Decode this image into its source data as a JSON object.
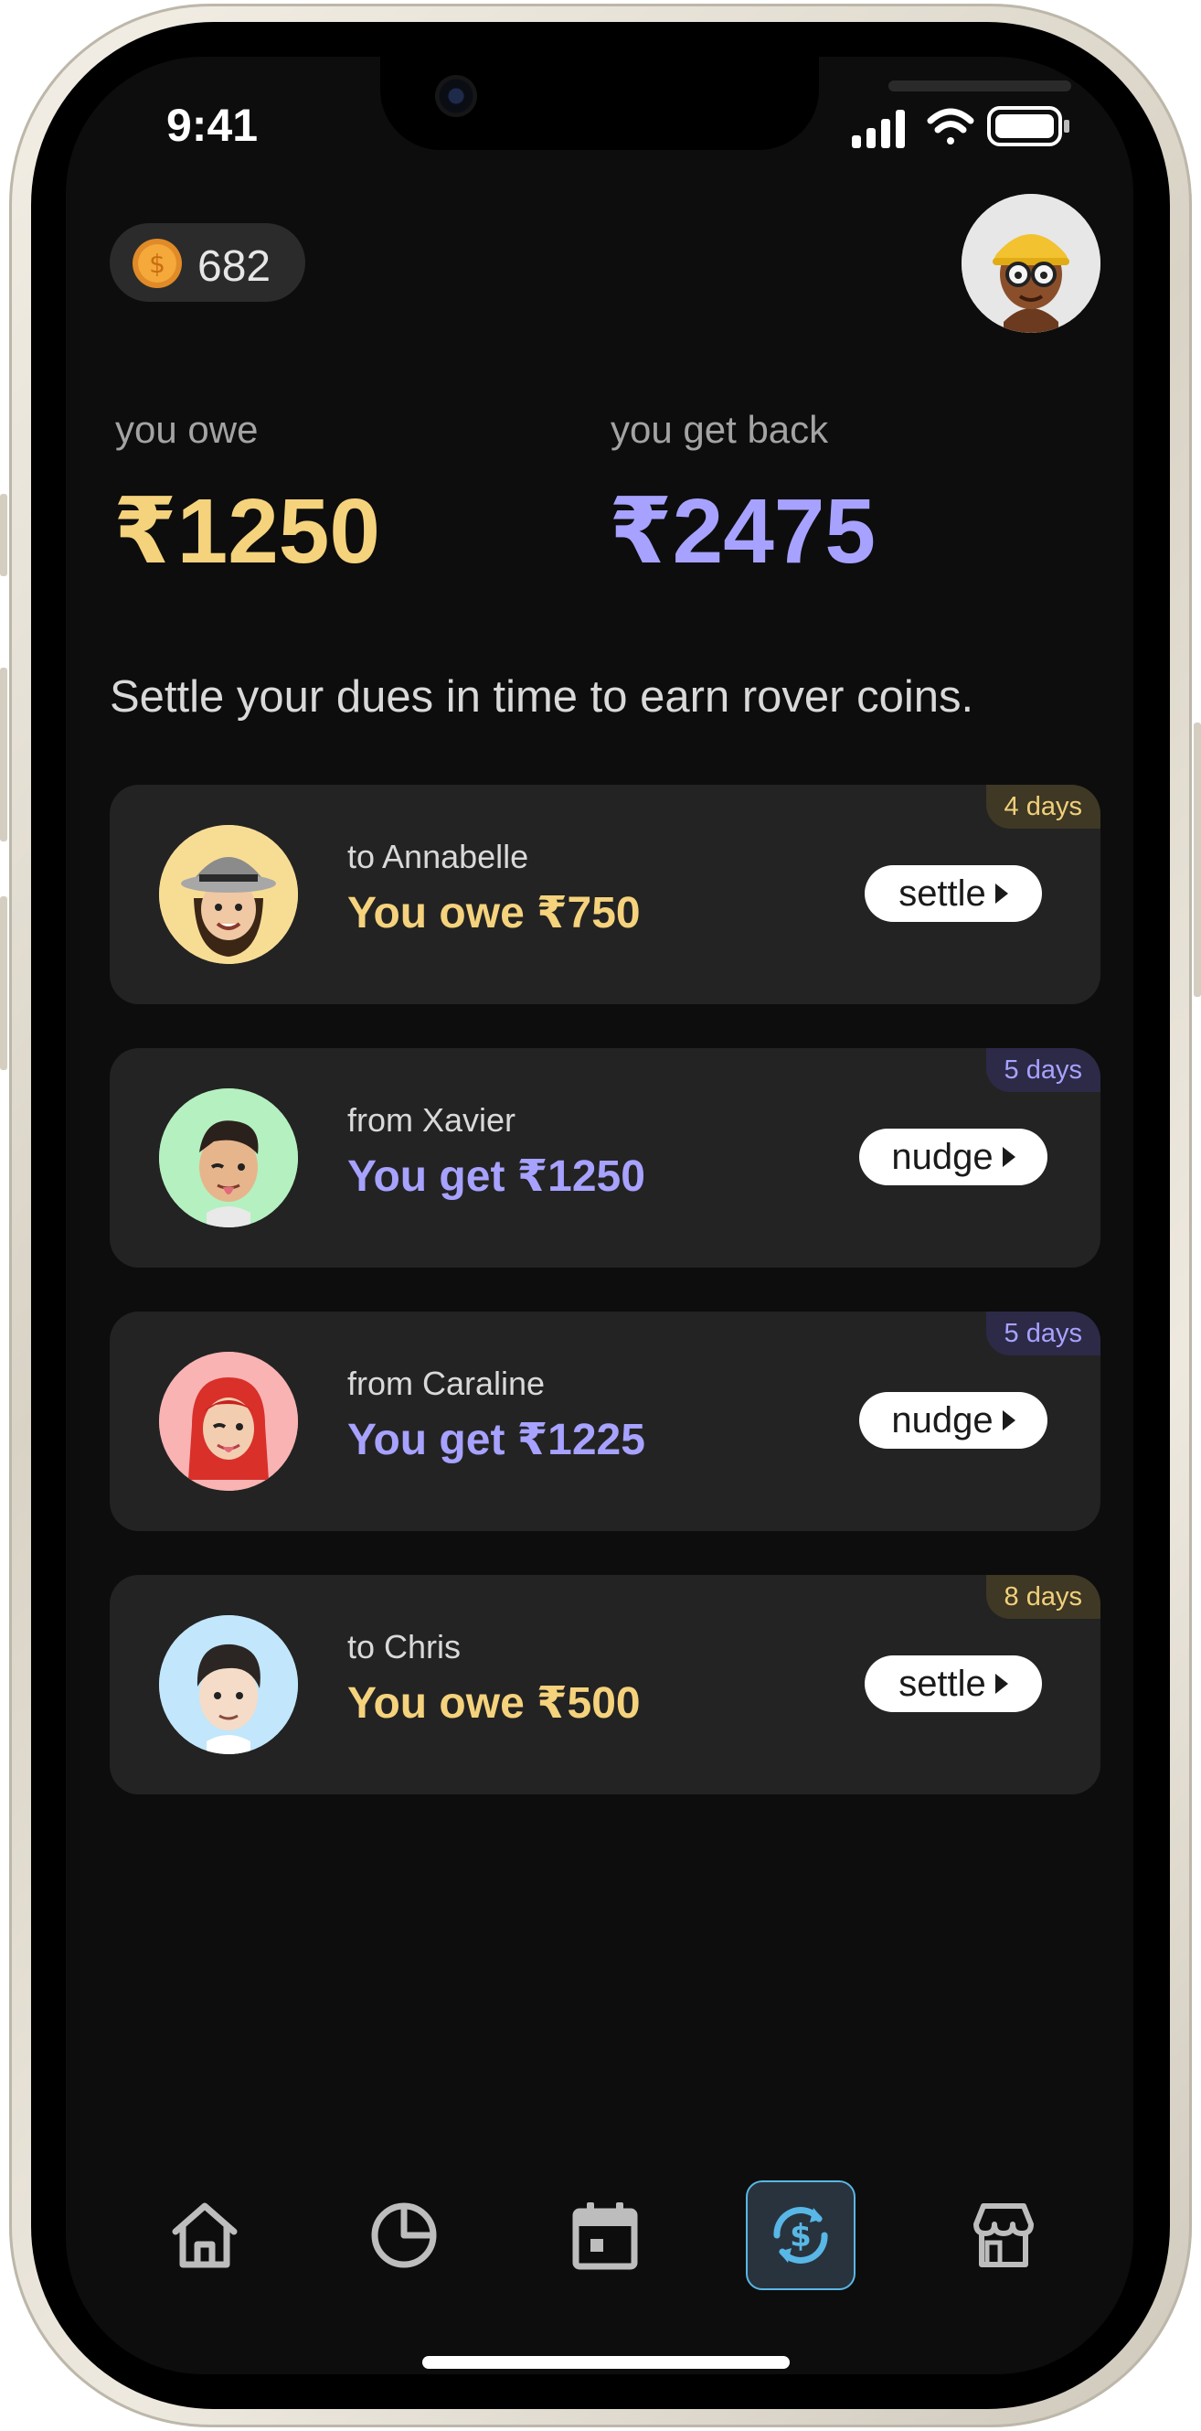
{
  "status_bar": {
    "time": "9:41"
  },
  "coins": {
    "count": "682"
  },
  "summary": {
    "owe_label": "you owe",
    "owe_amount": "₹1250",
    "back_label": "you get back",
    "back_amount": "₹2475"
  },
  "tagline": "Settle your dues in time to earn rover coins.",
  "dues": [
    {
      "subtitle": "to Annabelle",
      "amount": "You owe ₹750",
      "days": "4 days",
      "action": "settle",
      "tone": "yellow",
      "avatar_bg": "#f7dd94"
    },
    {
      "subtitle": "from Xavier",
      "amount": "You get ₹1250",
      "days": "5 days",
      "action": "nudge",
      "tone": "purple",
      "avatar_bg": "#b5f0c0"
    },
    {
      "subtitle": "from Caraline",
      "amount": "You get ₹1225",
      "days": "5 days",
      "action": "nudge",
      "tone": "purple",
      "avatar_bg": "#f9b3b3"
    },
    {
      "subtitle": "to Chris",
      "amount": "You owe ₹500",
      "days": "8 days",
      "action": "settle",
      "tone": "yellow",
      "avatar_bg": "#c2e6fb"
    }
  ],
  "tabbar": {
    "items": [
      {
        "icon": "home-icon",
        "active": false
      },
      {
        "icon": "pie-chart-icon",
        "active": false
      },
      {
        "icon": "calendar-icon",
        "active": false
      },
      {
        "icon": "currency-exchange-icon",
        "active": true
      },
      {
        "icon": "store-icon",
        "active": false
      }
    ]
  },
  "colors": {
    "owe": "#f5d27c",
    "get_back": "#a7a2ff",
    "background": "#0d0d0d",
    "card": "#232323",
    "active_tab": "#58b7e6"
  }
}
